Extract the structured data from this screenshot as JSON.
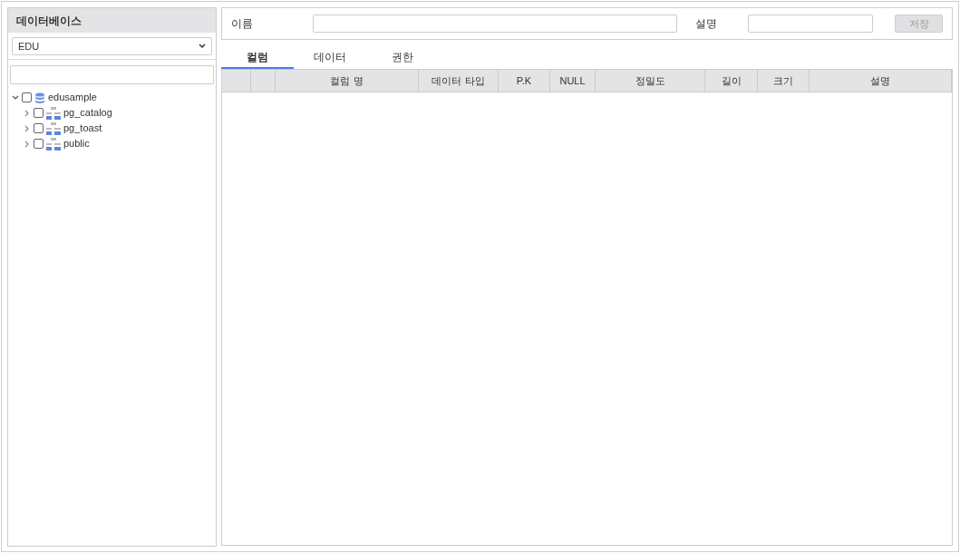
{
  "sidebar": {
    "title": "데이터베이스",
    "database_select": {
      "value": "EDU"
    },
    "tree": [
      {
        "label": "edusample",
        "kind": "database",
        "expanded": true,
        "checked": false,
        "children": [
          {
            "label": "pg_catalog",
            "kind": "schema",
            "expanded": false,
            "checked": false
          },
          {
            "label": "pg_toast",
            "kind": "schema",
            "expanded": false,
            "checked": false
          },
          {
            "label": "public",
            "kind": "schema",
            "expanded": false,
            "checked": false
          }
        ]
      }
    ]
  },
  "form": {
    "name_label": "이름",
    "description_label": "설명",
    "save_button": {
      "label": "저장",
      "disabled": true
    }
  },
  "tabs": [
    {
      "label": "컬럼",
      "selected": true
    },
    {
      "label": "데이터",
      "selected": false
    },
    {
      "label": "권한",
      "selected": false
    }
  ],
  "table": {
    "columns": [
      null,
      null,
      "컬럼 명",
      "데이터 타입",
      "P.K",
      "NULL",
      "정밀도",
      "길이",
      "크기",
      "설명"
    ]
  }
}
